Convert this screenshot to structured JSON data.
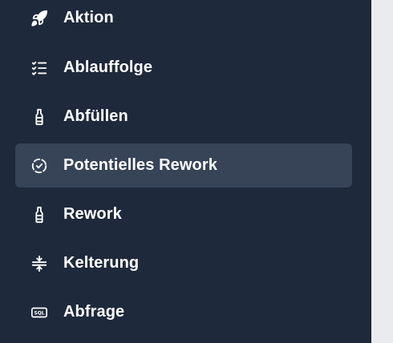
{
  "colors": {
    "sidebar_bg": "#1e293b",
    "active_bg": "#374357",
    "text": "#ffffff",
    "page_bg": "#e9ebef"
  },
  "sidebar": {
    "items": [
      {
        "label": "Aktion",
        "icon": "rocket-icon",
        "active": false
      },
      {
        "label": "Ablauffolge",
        "icon": "list-check-icon",
        "active": false
      },
      {
        "label": "Abfüllen",
        "icon": "bottle-icon",
        "active": false
      },
      {
        "label": "Potentielles Rework",
        "icon": "circle-check-dashed-icon",
        "active": true
      },
      {
        "label": "Rework",
        "icon": "bottle-icon",
        "active": false
      },
      {
        "label": "Kelterung",
        "icon": "press-icon",
        "active": false
      },
      {
        "label": "Abfrage",
        "icon": "sql-icon",
        "active": false
      }
    ]
  }
}
